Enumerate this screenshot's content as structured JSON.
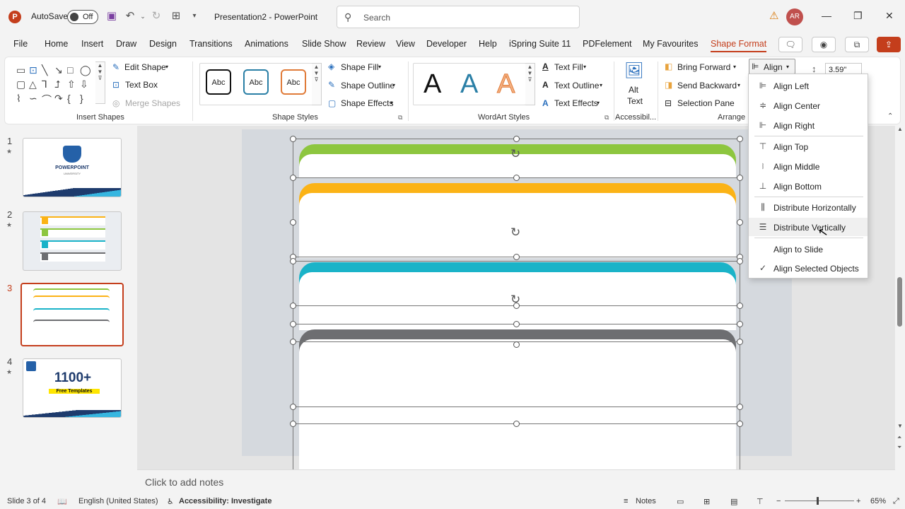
{
  "titlebar": {
    "autosave_label": "AutoSave",
    "autosave_state": "Off",
    "doc_title": "Presentation2  -  PowerPoint",
    "search_placeholder": "Search",
    "user_initials": "AR"
  },
  "tabs": [
    "File",
    "Home",
    "Insert",
    "Draw",
    "Design",
    "Transitions",
    "Animations",
    "Slide Show",
    "Review",
    "View",
    "Developer",
    "Help",
    "iSpring Suite 11",
    "PDFelement",
    "My Favourites",
    "Shape Format"
  ],
  "active_tab": "Shape Format",
  "ribbon": {
    "insert_shapes": {
      "edit_shape": "Edit Shape",
      "text_box": "Text Box",
      "merge_shapes": "Merge Shapes",
      "label": "Insert Shapes"
    },
    "shape_styles": {
      "samples": [
        "Abc",
        "Abc",
        "Abc"
      ],
      "shape_fill": "Shape Fill",
      "shape_outline": "Shape Outline",
      "shape_effects": "Shape Effects",
      "label": "Shape Styles"
    },
    "wordart": {
      "letters": [
        "A",
        "A",
        "A"
      ],
      "text_fill": "Text Fill",
      "text_outline": "Text Outline",
      "text_effects": "Text Effects",
      "label": "WordArt Styles"
    },
    "accessibility": {
      "alt_text_line1": "Alt",
      "alt_text_line2": "Text",
      "label": "Accessibil..."
    },
    "arrange": {
      "bring_forward": "Bring Forward",
      "send_backward": "Send Backward",
      "selection_pane": "Selection Pane",
      "align": "Align",
      "label": "Arrange"
    },
    "size": {
      "height": "3.59\""
    }
  },
  "thumbnails": [
    {
      "num": "1",
      "star": "★"
    },
    {
      "num": "2",
      "star": "★"
    },
    {
      "num": "3",
      "star": ""
    },
    {
      "num": "4",
      "star": "★"
    }
  ],
  "thumb_texts": {
    "t1_title": "POWERPOINT",
    "t1_sub": "UNIVERSITY",
    "t4_big": "1100+",
    "t4_banner": "Free Templates"
  },
  "align_menu": {
    "items": [
      {
        "label": "Align Left",
        "icon": "align-left-icon"
      },
      {
        "label": "Align Center",
        "icon": "align-center-icon"
      },
      {
        "label": "Align Right",
        "icon": "align-right-icon"
      },
      {
        "label": "Align Top",
        "icon": "align-top-icon"
      },
      {
        "label": "Align Middle",
        "icon": "align-middle-icon"
      },
      {
        "label": "Align Bottom",
        "icon": "align-bottom-icon"
      },
      {
        "label": "Distribute Horizontally",
        "icon": "distribute-horizontally-icon"
      },
      {
        "label": "Distribute Vertically",
        "icon": "distribute-vertically-icon"
      },
      {
        "label": "Align to Slide",
        "icon": ""
      },
      {
        "label": "Align Selected Objects",
        "icon": "checkmark-icon"
      }
    ],
    "hovered": "Distribute Vertically",
    "checked": "Align Selected Objects"
  },
  "slide": {
    "bar_colors": [
      "#8dc63f",
      "#fbb316",
      "#1ab3c8",
      "#6d6e71"
    ]
  },
  "notes_placeholder": "Click to add notes",
  "status": {
    "slide_info": "Slide 3 of 4",
    "language": "English (United States)",
    "accessibility": "Accessibility: Investigate",
    "notes": "Notes",
    "zoom": "65%"
  }
}
